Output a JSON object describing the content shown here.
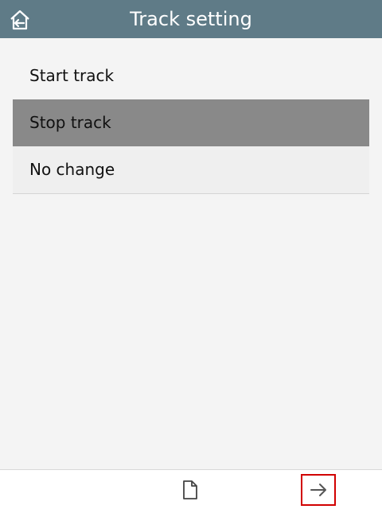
{
  "header": {
    "title": "Track setting",
    "home_icon": "home-back-icon"
  },
  "options": [
    {
      "label": "Start track",
      "selected": false
    },
    {
      "label": "Stop track",
      "selected": true
    },
    {
      "label": "No change",
      "selected": false
    }
  ],
  "footer": {
    "document_icon": "document-icon",
    "next_icon": "arrow-right-icon"
  },
  "colors": {
    "header_bg": "#5f7b87",
    "selected_row_bg": "#898989",
    "highlight_border": "#d10000"
  }
}
